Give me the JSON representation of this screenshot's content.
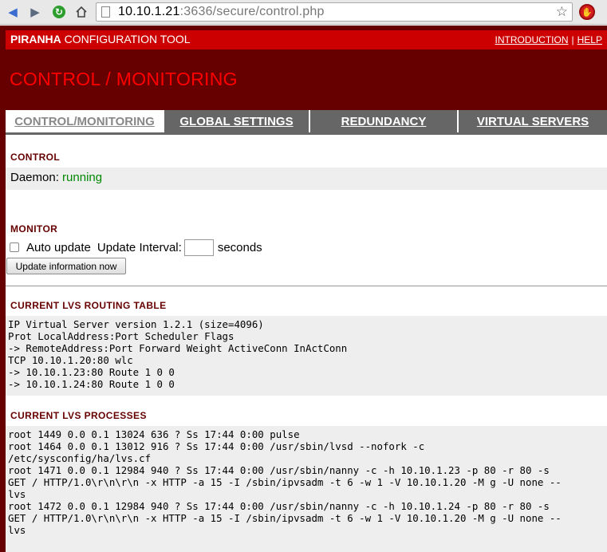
{
  "browser": {
    "url_host": "10.10.1.21",
    "url_rest": ":3636/secure/control.php"
  },
  "header": {
    "brand_bold": "PIRANHA",
    "brand_rest": " CONFIGURATION TOOL",
    "links": [
      "INTRODUCTION",
      "HELP"
    ],
    "link_separator": "|",
    "page_heading": "CONTROL / MONITORING"
  },
  "tabs": [
    {
      "label": "CONTROL/MONITORING",
      "active": true
    },
    {
      "label": "GLOBAL SETTINGS",
      "active": false
    },
    {
      "label": "REDUNDANCY",
      "active": false
    },
    {
      "label": "VIRTUAL SERVERS",
      "active": false
    }
  ],
  "control": {
    "title": "CONTROL",
    "daemon_label": "Daemon: ",
    "daemon_status": "running",
    "status_color": "#008800"
  },
  "monitor": {
    "title": "MONITOR",
    "auto_update_label": "Auto update",
    "auto_update_checked": false,
    "interval_label": "Update Interval:",
    "interval_value": "",
    "seconds_label": "seconds",
    "update_button": "Update information now"
  },
  "routing_table": {
    "title": "CURRENT LVS ROUTING TABLE",
    "lines": [
      "IP Virtual Server version 1.2.1 (size=4096)",
      "Prot LocalAddress:Port Scheduler Flags",
      "-> RemoteAddress:Port Forward Weight ActiveConn InActConn",
      "TCP 10.10.1.20:80 wlc",
      "-> 10.10.1.23:80 Route 1 0 0",
      "-> 10.10.1.24:80 Route 1 0 0"
    ]
  },
  "processes": {
    "title": "CURRENT LVS PROCESSES",
    "lines": [
      "root 1449 0.0 0.1 13024 636 ? Ss 17:44 0:00 pulse",
      "root 1464 0.0 0.1 13012 916 ? Ss 17:44 0:00 /usr/sbin/lvsd --nofork -c",
      "/etc/sysconfig/ha/lvs.cf",
      "root 1471 0.0 0.1 12984 940 ? Ss 17:44 0:00 /usr/sbin/nanny -c -h 10.10.1.23 -p 80 -r 80 -s",
      "GET / HTTP/1.0\\r\\n\\r\\n -x HTTP -a 15 -I /sbin/ipvsadm -t 6 -w 1 -V 10.10.1.20 -M g -U none --",
      "lvs",
      "root 1472 0.0 0.1 12984 940 ? Ss 17:44 0:00 /usr/sbin/nanny -c -h 10.10.1.24 -p 80 -r 80 -s",
      "GET / HTTP/1.0\\r\\n\\r\\n -x HTTP -a 15 -I /sbin/ipvsadm -t 6 -w 1 -V 10.10.1.20 -M g -U none --",
      "lvs"
    ]
  },
  "colors": {
    "page_bg": "#660000",
    "topbar": "#cc0000",
    "heading": "#ff0000",
    "tab_inactive": "#666666",
    "section_title": "#660000"
  },
  "icons": {
    "back": "back-arrow-icon",
    "forward": "forward-arrow-icon",
    "reload": "reload-icon",
    "home": "home-icon",
    "bookmark": "star-icon",
    "extension": "stop-extension-icon"
  }
}
